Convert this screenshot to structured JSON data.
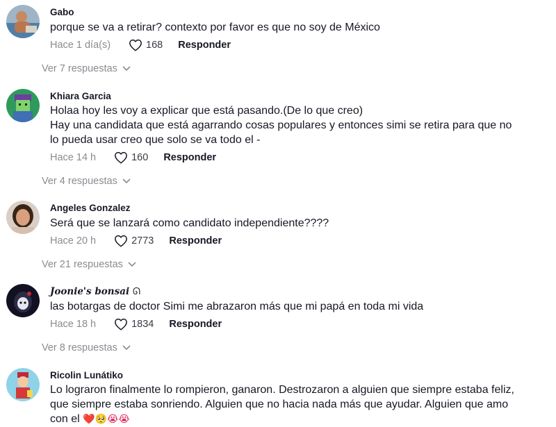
{
  "comments": [
    {
      "username": "Gabo",
      "text": "porque se va a retirar? contexto por favor es que no soy de México",
      "time": "Hace 1 día(s)",
      "likes": "168",
      "reply_label": "Responder",
      "view_replies": "Ver 7 respuestas"
    },
    {
      "username": "Khiara Garcia",
      "text": "Holaa hoy les voy a explicar que está pasando.(De lo que creo)\nHay una candidata que está agarrando cosas populares y entonces simi se retira para que no\nlo pueda usar creo que solo se va todo el -",
      "time": "Hace 14 h",
      "likes": "160",
      "reply_label": "Responder",
      "view_replies": "Ver 4 respuestas"
    },
    {
      "username": "Angeles Gonzalez",
      "text": "Será que se lanzará como candidato independiente????",
      "time": "Hace 20 h",
      "likes": "2773",
      "reply_label": "Responder",
      "view_replies": "Ver 21 respuestas"
    },
    {
      "username": "Joonie's bonsai",
      "username_suffix": "ᘏ",
      "text": "las botargas de doctor Simi me abrazaron más que mi papá en toda mi vida",
      "time": "Hace 18 h",
      "likes": "1834",
      "reply_label": "Responder",
      "view_replies": "Ver 8 respuestas"
    },
    {
      "username": "Ricolin Lunátiko",
      "text": "Lo lograron finalmente lo rompieron, ganaron. Destrozaron a alguien que siempre estaba feliz,\nque siempre estaba sonriendo. Alguien que no hacia nada más que ayudar. Alguien que amo\ncon el ",
      "text_emojis": "❤️🥺😭😭"
    }
  ],
  "icons": {
    "like": "heart-outline-icon",
    "expand": "chevron-down-icon"
  },
  "colors": {
    "text": "#161823",
    "muted": "#8a8b91",
    "background": "#ffffff",
    "heart_emoji": "#e0245e"
  }
}
